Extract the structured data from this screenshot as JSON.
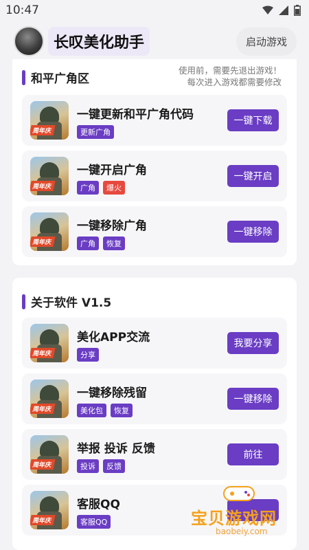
{
  "status": {
    "time": "10:47"
  },
  "header": {
    "title": "长叹美化助手",
    "launch_label": "启动游戏"
  },
  "section1": {
    "title": "和平广角区",
    "note_line1": "使用前，需要先退出游戏！",
    "note_line2": "每次进入游戏都需要修改",
    "items": [
      {
        "title": "一键更新和平广角代码",
        "tags": [
          "更新广角"
        ],
        "button": "一键下载"
      },
      {
        "title": "一键开启广角",
        "tags": [
          "广角",
          "爆火"
        ],
        "button": "一键开启"
      },
      {
        "title": "一键移除广角",
        "tags": [
          "广角",
          "恢复"
        ],
        "button": "一键移除"
      }
    ]
  },
  "section2": {
    "title": "关于软件 V1.5",
    "items": [
      {
        "title": "美化APP交流",
        "tags": [
          "分享"
        ],
        "button": "我要分享"
      },
      {
        "title": "一键移除残留",
        "tags": [
          "美化包",
          "恢复"
        ],
        "button": "一键移除"
      },
      {
        "title": "举报 投诉 反馈",
        "tags": [
          "投诉",
          "反馈"
        ],
        "button": "前往"
      },
      {
        "title": "客服QQ",
        "tags": [
          "客服QQ"
        ],
        "button": ""
      }
    ]
  },
  "icon_ribbon": "周年庆",
  "watermark": {
    "text": "宝贝游戏网",
    "url": "baobeiy.com"
  },
  "colors": {
    "accent": "#6a3dc4",
    "hot_tag": "#e6493e",
    "watermark": "#f5a11b"
  }
}
